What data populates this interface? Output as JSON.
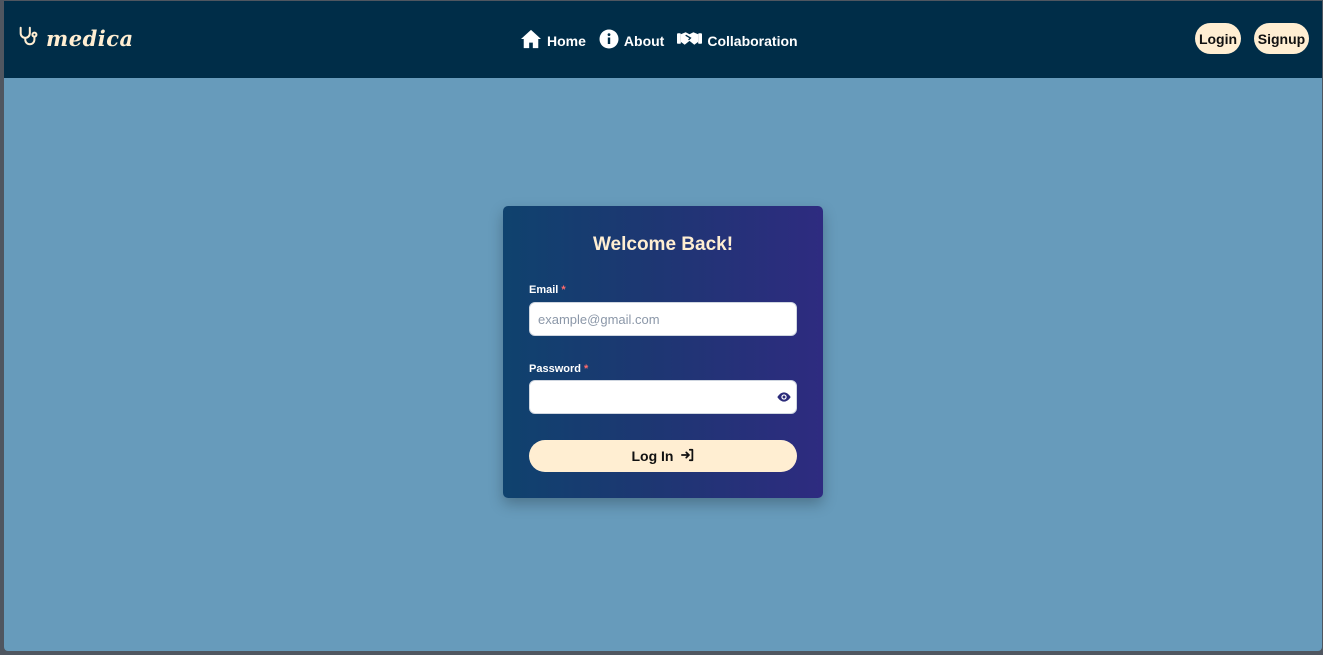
{
  "brand": {
    "name": "medica",
    "icon": "stethoscope-icon",
    "color": "#ffeed2"
  },
  "nav": {
    "links": [
      {
        "label": "Home",
        "icon": "home-icon"
      },
      {
        "label": "About",
        "icon": "info-icon"
      },
      {
        "label": "Collaboration",
        "icon": "handshake-icon"
      }
    ],
    "login_label": "Login",
    "signup_label": "Signup"
  },
  "login_form": {
    "title": "Welcome Back!",
    "email_label": "Email",
    "email_placeholder": "example@gmail.com",
    "email_value": "",
    "password_label": "Password",
    "password_value": "",
    "required_marker": "*",
    "submit_label": "Log In",
    "submit_icon": "sign-in-icon",
    "toggle_icon": "eye-icon"
  },
  "colors": {
    "navbar_bg": "#002d48",
    "page_bg": "#679bbb",
    "accent": "#ffeed2",
    "card_gradient_start": "#0f426e",
    "card_gradient_end": "#2e2b80",
    "required": "#ff6b6b"
  }
}
